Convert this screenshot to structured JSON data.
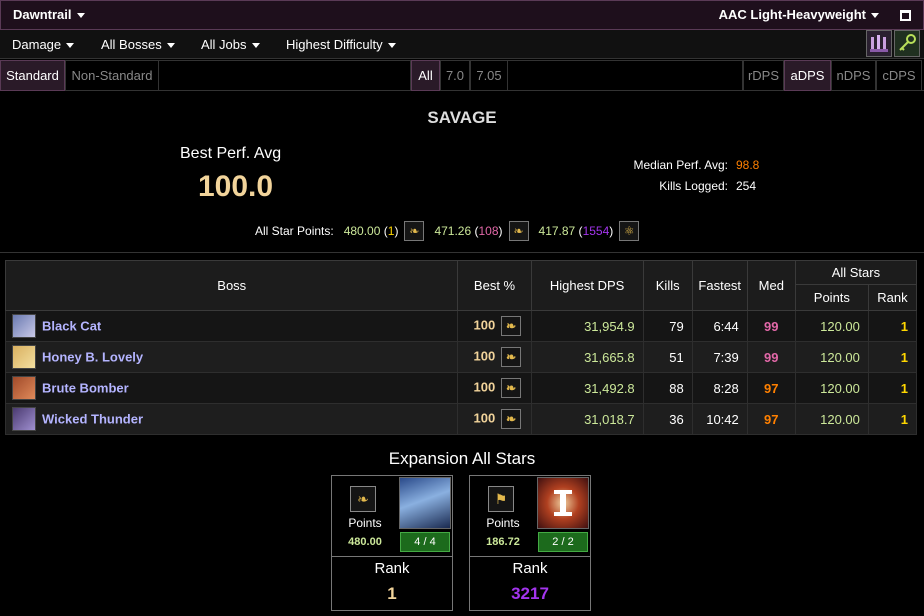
{
  "topbar": {
    "expansion": "Dawntrail",
    "zone": "AAC Light-Heavyweight"
  },
  "menu": {
    "metric": "Damage",
    "bosses": "All Bosses",
    "jobs": "All Jobs",
    "difficulty": "Highest Difficulty"
  },
  "filters": {
    "standard": "Standard",
    "non_standard": "Non-Standard",
    "all": "All",
    "v70": "7.0",
    "v705": "7.05",
    "rdps": "rDPS",
    "adps": "aDPS",
    "ndps": "nDPS",
    "cdps": "cDPS"
  },
  "summary": {
    "section_title": "SAVAGE",
    "best_perf_label": "Best Perf. Avg",
    "best_perf_value": "100.0",
    "median_label": "Median Perf. Avg:",
    "median_value": "98.8",
    "kills_label": "Kills Logged:",
    "kills_value": "254",
    "all_star_label": "All Star Points:",
    "asp1": "480.00",
    "asp1_rank": "1",
    "asp2": "471.26",
    "asp2_rank": "108",
    "asp3": "417.87",
    "asp3_rank": "1554"
  },
  "table": {
    "headers": {
      "boss": "Boss",
      "best": "Best %",
      "highest_dps": "Highest DPS",
      "kills": "Kills",
      "fastest": "Fastest",
      "med": "Med",
      "all_stars": "All Stars",
      "points": "Points",
      "rank": "Rank"
    },
    "rows": [
      {
        "boss": "Black Cat",
        "best": "100",
        "dps": "31,954.9",
        "kills": "79",
        "fastest": "6:44",
        "med": "99",
        "points": "120.00",
        "rank": "1"
      },
      {
        "boss": "Honey B. Lovely",
        "best": "100",
        "dps": "31,665.8",
        "kills": "51",
        "fastest": "7:39",
        "med": "99",
        "points": "120.00",
        "rank": "1"
      },
      {
        "boss": "Brute Bomber",
        "best": "100",
        "dps": "31,492.8",
        "kills": "88",
        "fastest": "8:28",
        "med": "97",
        "points": "120.00",
        "rank": "1"
      },
      {
        "boss": "Wicked Thunder",
        "best": "100",
        "dps": "31,018.7",
        "kills": "36",
        "fastest": "10:42",
        "med": "97",
        "points": "120.00",
        "rank": "1"
      }
    ]
  },
  "expansion": {
    "title": "Expansion All Stars",
    "cards": [
      {
        "points_label": "Points",
        "points": "480.00",
        "count": "4 / 4",
        "rank_label": "Rank",
        "rank": "1"
      },
      {
        "points_label": "Points",
        "points": "186.72",
        "count": "2 / 2",
        "rank_label": "Rank",
        "rank": "3217"
      }
    ]
  },
  "colors": {
    "gold": "#f2d49b",
    "pink": "#e268a8",
    "orange": "#ff8000",
    "purple": "#a335ee",
    "green": "#cce89a",
    "name": "#b4b4ff"
  }
}
